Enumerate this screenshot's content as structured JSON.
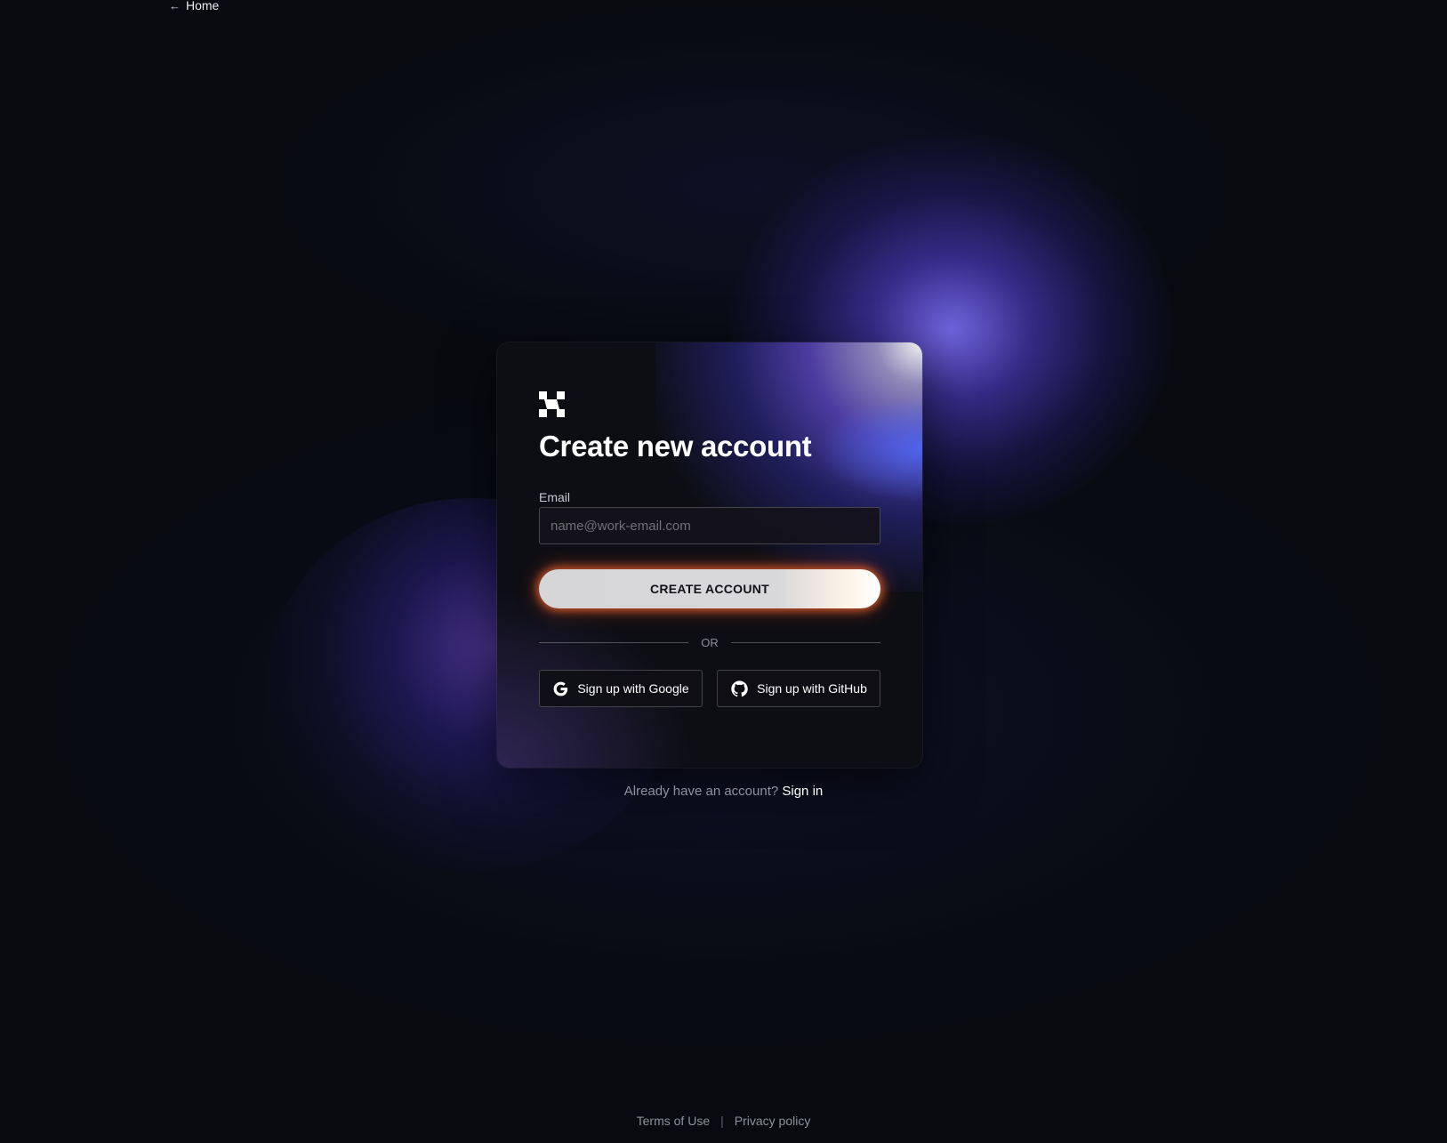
{
  "nav": {
    "home_arrow": "←",
    "home_label": "Home"
  },
  "card": {
    "logo_icon": "brand-logo-icon",
    "title": "Create new account",
    "email_label": "Email",
    "email_placeholder": "name@work-email.com",
    "email_value": "",
    "create_button_label": "CREATE ACCOUNT",
    "divider_text": "OR",
    "google_button_label": "Sign up with Google",
    "google_icon": "google-icon",
    "github_button_label": "Sign up with GitHub",
    "github_icon": "github-icon"
  },
  "signin": {
    "prompt": "Already have an account?",
    "link_label": "Sign in"
  },
  "footer": {
    "terms_label": "Terms of Use",
    "separator": "|",
    "privacy_label": "Privacy policy"
  },
  "colors": {
    "background": "#080a10",
    "card": "#0d0e14",
    "accent_glow": "#7f74ff",
    "button_glow": "#ff6e32"
  }
}
